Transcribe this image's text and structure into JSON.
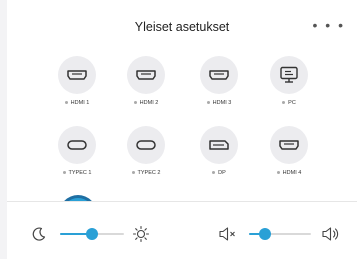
{
  "header": {
    "title": "Yleiset asetukset",
    "more_label": "• • •"
  },
  "sources": [
    {
      "label": "HDMI 1",
      "icon": "hdmi-port-icon"
    },
    {
      "label": "HDMI 2",
      "icon": "hdmi-port-icon"
    },
    {
      "label": "HDMI 3",
      "icon": "hdmi-port-icon"
    },
    {
      "label": "PC",
      "icon": "monitor-icon"
    },
    {
      "label": "TYPEC 1",
      "icon": "usb-c-port-icon"
    },
    {
      "label": "TYPEC 2",
      "icon": "usb-c-port-icon"
    },
    {
      "label": "DP",
      "icon": "displayport-icon"
    },
    {
      "label": "HDMI 4",
      "icon": "hdmi-port-icon"
    }
  ],
  "brightness": {
    "level": 0.5,
    "low_icon": "moon-icon",
    "high_icon": "sun-icon"
  },
  "volume": {
    "level": 0.25,
    "low_icon": "mute-icon",
    "high_icon": "speaker-icon"
  },
  "colors": {
    "accent": "#2aa0d6",
    "circle": "#ececef"
  }
}
